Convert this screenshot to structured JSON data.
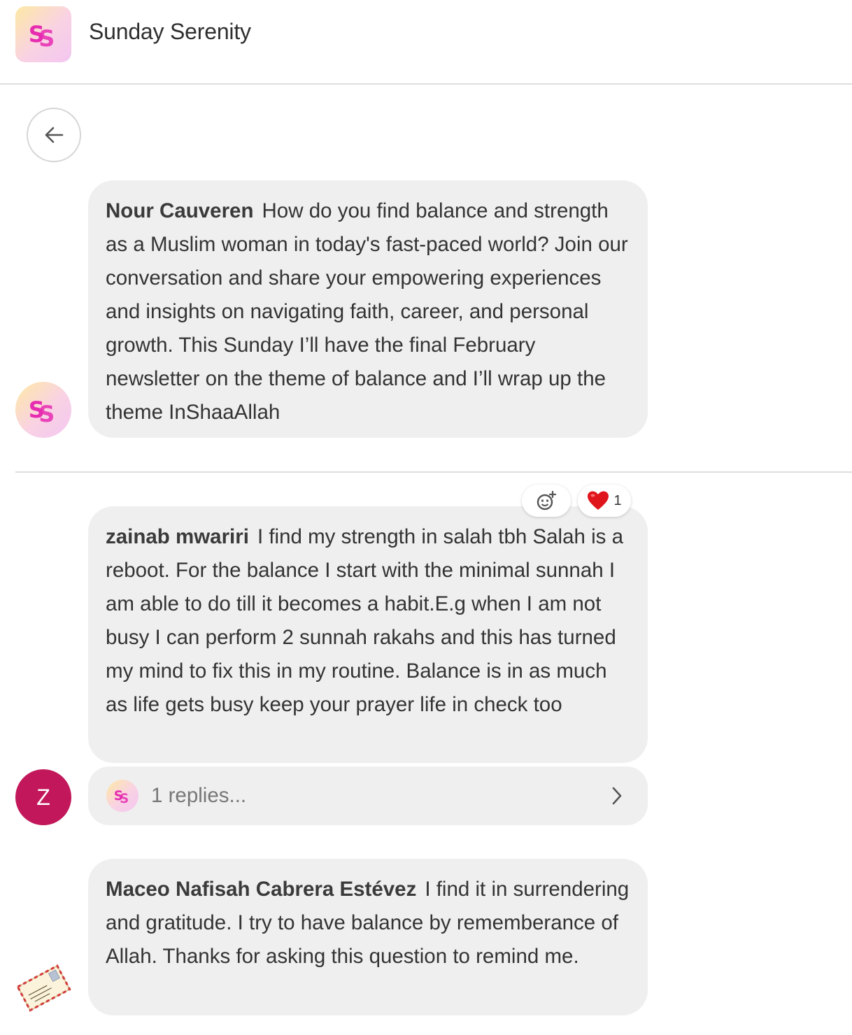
{
  "header": {
    "app_title": "Sunday Serenity",
    "logo_icon": "ss-logo-icon"
  },
  "navigation": {
    "back_icon": "arrow-left-icon"
  },
  "posts": [
    {
      "author": "Nour Cauveren",
      "text": "How do you find balance and strength as a Muslim woman in today's fast-paced world? Join our conversation and share your empowering experiences and insights on navigating faith, career, and personal growth. This Sunday I’ll have the final February newsletter on the theme of balance and I’ll wrap up the theme InShaaAllah",
      "avatar": "ss-logo-icon"
    },
    {
      "author": "zainab mwariri",
      "text": "I find my strength in salah tbh Salah is a reboot. For the balance I start with the minimal sunnah I am able to do till it becomes a habit.E.g when I am not busy I can perform 2 sunnah rakahs and this has turned my mind to fix this in my routine. Balance is in as much as life gets busy keep your prayer life in check too",
      "avatar_letter": "Z",
      "reactions": {
        "add_icon": "add-reaction-icon",
        "heart_icon": "heart-icon",
        "heart_count": "1"
      },
      "replies": {
        "label": "1 replies...",
        "avatar": "ss-logo-icon",
        "chevron": "chevron-right-icon"
      }
    },
    {
      "author": "Maceo Nafisah Cabrera Estévez",
      "text": "I find it in surrendering and gratitude. I try to have balance by rememberance of Allah. Thanks for asking this question to remind me.",
      "avatar": "envelope-stamp-icon"
    }
  ],
  "colors": {
    "bubble": "#efefef",
    "avatar_z": "#c2185b",
    "logo_pink": "#e62cb0",
    "heart": "#e0151c"
  }
}
